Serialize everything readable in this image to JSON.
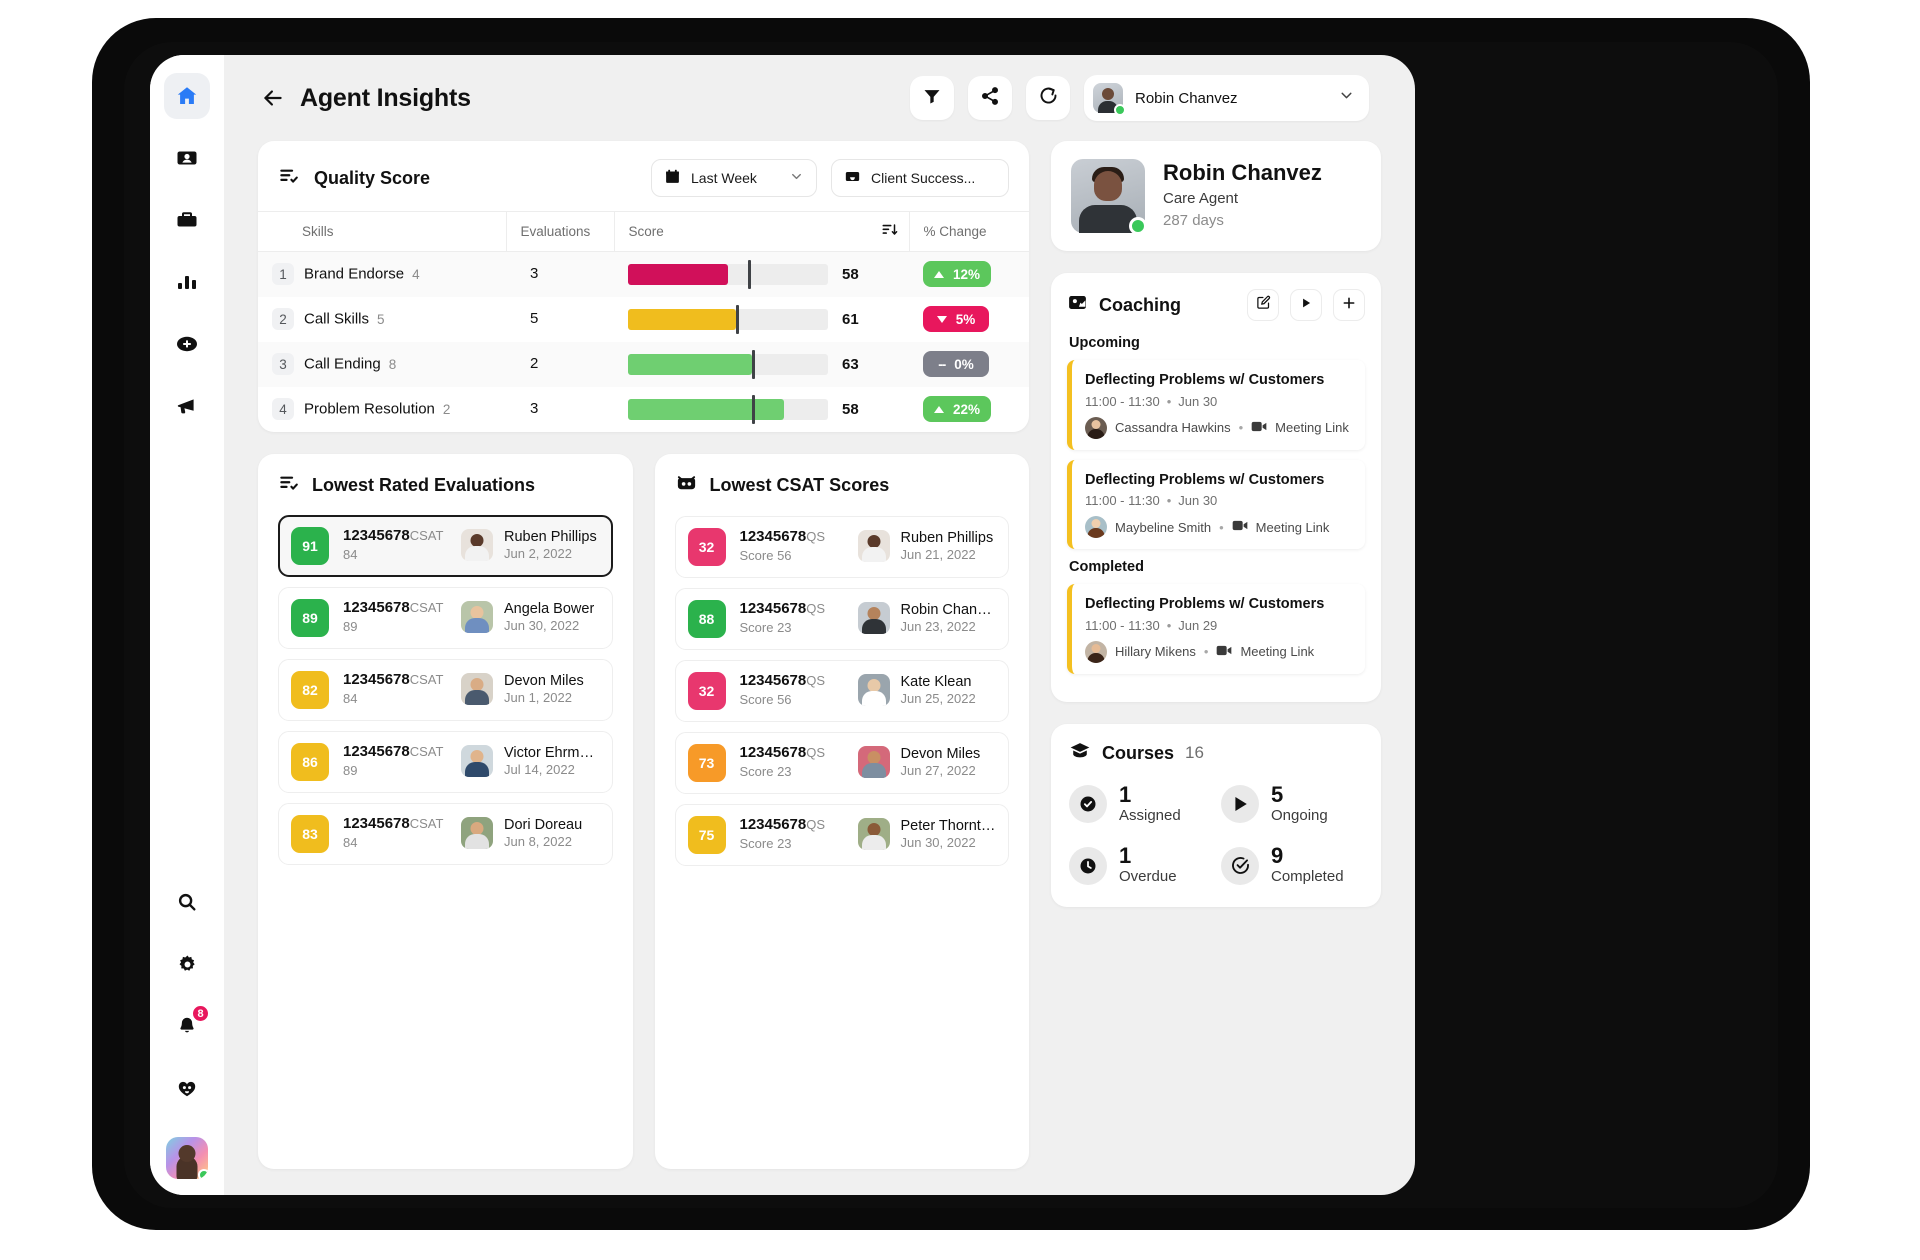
{
  "sidebar": {
    "items": [
      {
        "name": "home",
        "icon": "home-icon",
        "active": true
      },
      {
        "name": "contacts",
        "icon": "id-card-icon",
        "active": false
      },
      {
        "name": "work",
        "icon": "briefcase-icon",
        "active": false
      },
      {
        "name": "analytics",
        "icon": "bar-chart-icon",
        "active": false
      },
      {
        "name": "add",
        "icon": "plus-circle-icon",
        "active": false
      },
      {
        "name": "announcements",
        "icon": "megaphone-icon",
        "active": false
      }
    ],
    "bottom_items": [
      {
        "name": "search",
        "icon": "search-icon",
        "badge": ""
      },
      {
        "name": "settings",
        "icon": "gear-icon",
        "badge": ""
      },
      {
        "name": "notifications",
        "icon": "bell-icon",
        "badge": "8"
      },
      {
        "name": "support",
        "icon": "heart-headset-icon",
        "badge": ""
      }
    ]
  },
  "header": {
    "title": "Agent Insights",
    "back_icon": "arrow-left-icon",
    "filter_icon": "filter-icon",
    "share_icon": "share-icon",
    "refresh_icon": "refresh-forward-icon",
    "user": {
      "name": "Robin Chanvez",
      "chevron_icon": "chevron-down-icon",
      "status": "online"
    }
  },
  "quality_score": {
    "title": "Quality Score",
    "title_icon": "list-check-icon",
    "period_filter": {
      "label": "Last Week",
      "icon": "calendar-icon",
      "chevron": "chevron-down-icon"
    },
    "team_filter": {
      "label": "Client Success...",
      "icon": "inbox-icon"
    },
    "columns": [
      "Skills",
      "Evaluations",
      "Score",
      "% Change"
    ],
    "sort_icon": "sort-desc-icon",
    "rows": [
      {
        "rank": "1",
        "skill": "Brand Endorse",
        "skill_count": "4",
        "evaluations": "3",
        "bar_pct": 50,
        "marker_pct": 60,
        "bar_color": "#d1105a",
        "score": "58",
        "change": "12%",
        "change_dir": "up",
        "change_color": "#5cc75c"
      },
      {
        "rank": "2",
        "skill": "Call Skills",
        "skill_count": "5",
        "evaluations": "5",
        "bar_pct": 54,
        "marker_pct": 54,
        "bar_color": "#f0bd1e",
        "score": "61",
        "change": "5%",
        "change_dir": "down",
        "change_color": "#e8175d"
      },
      {
        "rank": "3",
        "skill": "Call Ending",
        "skill_count": "8",
        "evaluations": "2",
        "bar_pct": 62,
        "marker_pct": 62,
        "bar_color": "#6fcf71",
        "score": "63",
        "change": "0%",
        "change_dir": "flat",
        "change_color": "#7d7f8a"
      },
      {
        "rank": "4",
        "skill": "Problem Resolution",
        "skill_count": "2",
        "evaluations": "3",
        "bar_pct": 78,
        "marker_pct": 62,
        "bar_color": "#6fcf71",
        "score": "58",
        "change": "22%",
        "change_dir": "up",
        "change_color": "#5cc75c"
      }
    ]
  },
  "lowest_rated": {
    "title": "Lowest Rated Evaluations",
    "title_icon": "list-check-icon",
    "items": [
      {
        "score": "91",
        "score_color": "#2bb24c",
        "id": "12345678",
        "sub": "CSAT 84",
        "person": "Ruben Phillips",
        "date": "Jun 2, 2022",
        "selected": true,
        "skin": "#5a3a2a",
        "shirt": "#f2f2f2",
        "bg": "#e8e2dc"
      },
      {
        "score": "89",
        "score_color": "#2bb24c",
        "id": "12345678",
        "sub": "CSAT 89",
        "person": "Angela Bower",
        "date": "Jun 30, 2022",
        "selected": false,
        "skin": "#e8c39e",
        "shirt": "#6f8fc0",
        "bg": "#b9c5a9"
      },
      {
        "score": "82",
        "score_color": "#f0bd1e",
        "id": "12345678",
        "sub": "CSAT 84",
        "person": "Devon Miles",
        "date": "Jun 1, 2022",
        "selected": false,
        "skin": "#d9ac85",
        "shirt": "#4a5a6e",
        "bg": "#d8d2c8"
      },
      {
        "score": "86",
        "score_color": "#f0bd1e",
        "id": "12345678",
        "sub": "CSAT 89",
        "person": "Victor Ehrma...",
        "date": "Jul 14, 2022",
        "selected": false,
        "skin": "#e0b48c",
        "shirt": "#2f4a6b",
        "bg": "#cfd8dd"
      },
      {
        "score": "83",
        "score_color": "#f0bd1e",
        "id": "12345678",
        "sub": "CSAT 84",
        "person": "Dori Doreau",
        "date": "Jun 8, 2022",
        "selected": false,
        "skin": "#d9a97f",
        "shirt": "#e2e2e2",
        "bg": "#8fa37e"
      }
    ]
  },
  "lowest_csat": {
    "title": "Lowest CSAT Scores",
    "title_icon": "robot-icon",
    "items": [
      {
        "score": "32",
        "score_color": "#e8376e",
        "id": "12345678",
        "sub": "QS Score 56",
        "person": "Ruben Phillips",
        "date": "Jun 21, 2022",
        "skin": "#5a3a2a",
        "shirt": "#f2f2f2",
        "bg": "#e8e2dc"
      },
      {
        "score": "88",
        "score_color": "#2bb24c",
        "id": "12345678",
        "sub": "QS Score 23",
        "person": "Robin Chanvez",
        "date": "Jun 23, 2022",
        "skin": "#b5835c",
        "shirt": "#2f3337",
        "bg": "#c6ccd2"
      },
      {
        "score": "32",
        "score_color": "#e8376e",
        "id": "12345678",
        "sub": "QS Score 56",
        "person": "Kate Klean",
        "date": "Jun 25, 2022",
        "skin": "#e8c9a8",
        "shirt": "#ffffff",
        "bg": "#9aa5ad"
      },
      {
        "score": "73",
        "score_color": "#f79a28",
        "id": "12345678",
        "sub": "QS Score 23",
        "person": "Devon Miles",
        "date": "Jun 27, 2022",
        "skin": "#c98f63",
        "shirt": "#7d8ea0",
        "bg": "#d4697a"
      },
      {
        "score": "75",
        "score_color": "#f0bd1e",
        "id": "12345678",
        "sub": "QS Score 23",
        "person": "Peter Thornton",
        "date": "Jun 30, 2022",
        "skin": "#8a5a38",
        "shirt": "#ececec",
        "bg": "#9fae87"
      }
    ]
  },
  "profile": {
    "name": "Robin Chanvez",
    "role": "Care Agent",
    "tenure": "287 days",
    "status": "online"
  },
  "coaching": {
    "title": "Coaching",
    "title_icon": "coaching-icon",
    "actions": [
      {
        "name": "edit",
        "icon": "edit-square-icon"
      },
      {
        "name": "play",
        "icon": "play-icon"
      },
      {
        "name": "add",
        "icon": "plus-icon"
      }
    ],
    "upcoming_label": "Upcoming",
    "completed_label": "Completed",
    "accent_color": "#f4c020",
    "upcoming": [
      {
        "title": "Deflecting Problems w/ Customers",
        "time": "11:00 - 11:30",
        "date": "Jun 30",
        "person": "Cassandra Hawkins",
        "link_label": "Meeting Link",
        "link_icon": "video-camera-icon",
        "skin": "#e8c3a0",
        "hair": "#2a1d16",
        "bg": "#6b5d52"
      },
      {
        "title": "Deflecting Problems w/ Customers",
        "time": "11:00 - 11:30",
        "date": "Jun 30",
        "person": "Maybeline Smith",
        "link_label": "Meeting Link",
        "link_icon": "video-camera-icon",
        "skin": "#f0cfae",
        "hair": "#6b3a1e",
        "bg": "#a8bfc8"
      }
    ],
    "completed": [
      {
        "title": "Deflecting Problems w/ Customers",
        "time": "11:00 - 11:30",
        "date": "Jun 29",
        "person": "Hillary Mikens",
        "link_label": "Meeting Link",
        "link_icon": "video-camera-icon",
        "skin": "#e6bb95",
        "hair": "#3a2418",
        "bg": "#c2b4a4"
      }
    ]
  },
  "courses": {
    "title": "Courses",
    "title_icon": "graduation-cap-icon",
    "total": "16",
    "stats": [
      {
        "num": "1",
        "label": "Assigned",
        "icon": "check-circle-filled-icon"
      },
      {
        "num": "5",
        "label": "Ongoing",
        "icon": "play-triangle-icon"
      },
      {
        "num": "1",
        "label": "Overdue",
        "icon": "clock-icon"
      },
      {
        "num": "9",
        "label": "Completed",
        "icon": "check-circle-outline-icon"
      }
    ]
  }
}
